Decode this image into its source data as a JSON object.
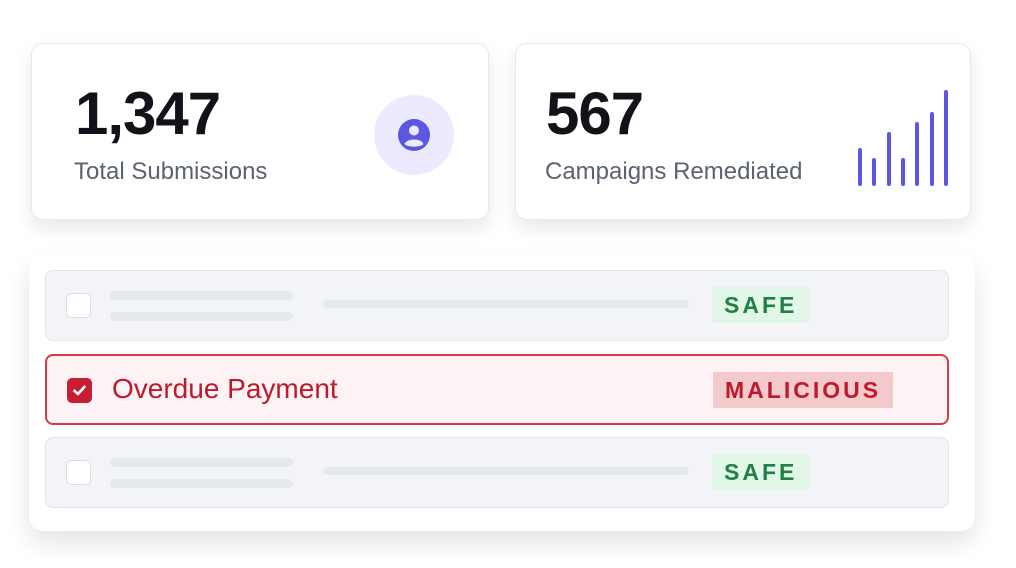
{
  "stats": {
    "submissions": {
      "value": "1,347",
      "label": "Total Submissions",
      "icon": "user-circle-icon"
    },
    "campaigns": {
      "value": "567",
      "label": "Campaigns Remediated",
      "icon": "bar-chart-icon"
    }
  },
  "colors": {
    "accent": "#5b57e0",
    "malicious": "#bd1a2c",
    "safe": "#1f8145"
  },
  "emails": [
    {
      "subject": "",
      "status": "SAFE",
      "checked": false
    },
    {
      "subject": "Overdue Payment",
      "status": "MALICIOUS",
      "checked": true
    },
    {
      "subject": "",
      "status": "SAFE",
      "checked": false
    }
  ]
}
